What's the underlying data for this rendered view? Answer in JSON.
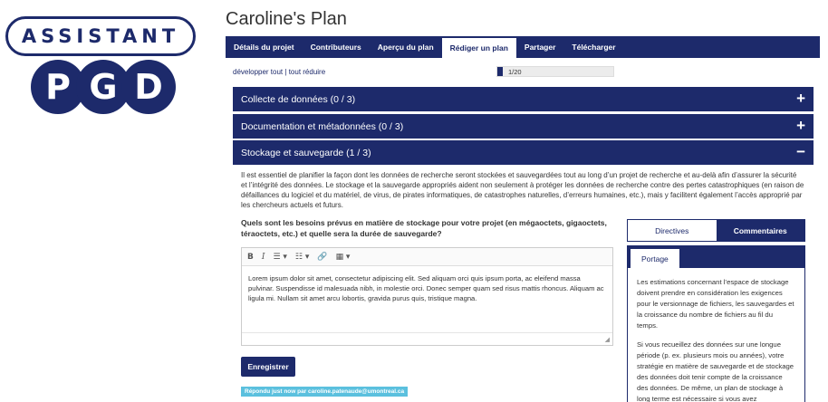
{
  "logo": {
    "banner_text": "ASSISTANT",
    "letters": [
      "P",
      "G",
      "D"
    ]
  },
  "plan": {
    "title": "Caroline's Plan"
  },
  "tabs": [
    {
      "label": "Détails du projet",
      "active": false
    },
    {
      "label": "Contributeurs",
      "active": false
    },
    {
      "label": "Aperçu du plan",
      "active": false
    },
    {
      "label": "Rédiger un plan",
      "active": true
    },
    {
      "label": "Partager",
      "active": false
    },
    {
      "label": "Télécharger",
      "active": false
    }
  ],
  "expand": {
    "expand_all": "développer tout",
    "separator": "|",
    "collapse_all": "tout réduire"
  },
  "progress": {
    "text": "1/20",
    "fraction": 0.05
  },
  "sections": [
    {
      "label": "Collecte de données (0 / 3)",
      "toggle": "+"
    },
    {
      "label": "Documentation et métadonnées (0 / 3)",
      "toggle": "+"
    },
    {
      "label": "Stockage et sauvegarde (1 / 3)",
      "toggle": "−"
    }
  ],
  "intro": "Il est essentiel de planifier la façon dont les données de recherche seront stockées et sauvegardées tout au long d’un projet de recherche et au-delà afin d’assurer la sécurité et l’intégrité des données. Le stockage et la sauvegarde appropriés aident non seulement à protéger les données de recherche contre des pertes catastrophiques (en raison de défaillances du logiciel et du matériel, de virus, de pirates informatiques, de catastrophes naturelles, d’erreurs humaines, etc.), mais y facilitent également l’accès approprié par les chercheurs actuels et futurs.",
  "question": "Quels sont les besoins prévus en matière de stockage pour votre projet (en mégaoctets, gigaoctets, téraoctets, etc.) et quelle sera la durée de sauvegarde?",
  "editor": {
    "toolbar": {
      "bold": "B",
      "italic": "I",
      "bullets": "☰ ▾",
      "numbers": "☷ ▾",
      "link": "🔗",
      "table": "▦ ▾"
    },
    "content": "Lorem ipsum dolor sit amet, consectetur adipiscing elit. Sed aliquam orci quis ipsum porta, ac eleifend massa pulvinar. Suspendisse id malesuada nibh, in molestie orci. Donec semper quam sed risus mattis rhoncus. Aliquam ac ligula mi. Nullam sit amet arcu lobortis, gravida purus quis, tristique magna."
  },
  "save_label": "Enregistrer",
  "answered_label": "Répondu just now par caroline.patenaude@umontreal.ca",
  "side": {
    "tabs": [
      {
        "label": "Directives",
        "active": false
      },
      {
        "label": "Commentaires",
        "active": true
      }
    ],
    "panel_tab": "Portage",
    "paragraphs": [
      "Les estimations concernant l’espace de stockage doivent prendre en considération les exigences pour le versionnage de fichiers, les sauvegardes et la croissance du nombre de fichiers au fil du temps.",
      "Si vous recueillez des données sur une longue période (p. ex. plusieurs mois ou années), votre stratégie en matière de sauvegarde et de stockage des données doit tenir compte de la croissance des données. De même, un plan de stockage à long terme est nécessaire si vous avez"
    ]
  },
  "colors": {
    "primary": "#1d2a6b",
    "answered_badge": "#5bc0de",
    "progress_track": "#ececec"
  }
}
